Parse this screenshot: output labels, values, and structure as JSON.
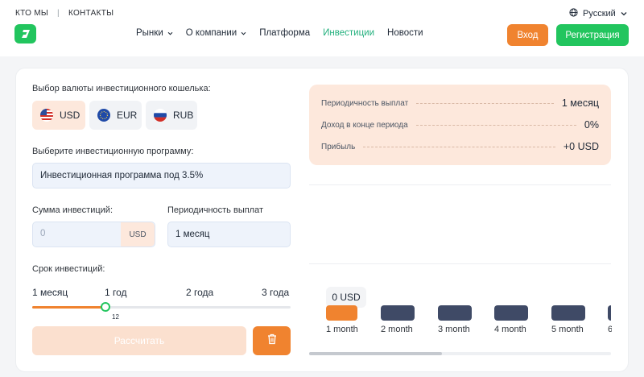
{
  "header": {
    "top_links": [
      "КТО МЫ",
      "КОНТАКТЫ"
    ],
    "language": "Русский",
    "nav": [
      {
        "label": "Рынки",
        "dropdown": true
      },
      {
        "label": "О компании",
        "dropdown": true
      },
      {
        "label": "Платформа",
        "dropdown": false
      },
      {
        "label": "Инвестиции",
        "dropdown": false,
        "active": true
      },
      {
        "label": "Новости",
        "dropdown": false
      }
    ],
    "login_label": "Вход",
    "register_label": "Регистрация"
  },
  "form": {
    "currency_label": "Выбор валюты инвестиционного кошелька:",
    "currencies": [
      {
        "code": "USD",
        "flag": "us-flag-icon",
        "selected": true
      },
      {
        "code": "EUR",
        "flag": "eu-flag-icon",
        "selected": false
      },
      {
        "code": "RUB",
        "flag": "ru-flag-icon",
        "selected": false
      }
    ],
    "program_label": "Выберите инвестиционную программу:",
    "program_value": "Инвестиционная программа под 3.5%",
    "amount_label": "Сумма инвестиций:",
    "amount_placeholder": "0",
    "amount_unit": "USD",
    "payout_label": "Периодичность выплат",
    "payout_value": "1 месяц",
    "term_label": "Срок инвестиций:",
    "term_ticks": [
      "1 месяц",
      "1 год",
      "2 года",
      "3 года"
    ],
    "term_value": "12",
    "term_min": 1,
    "term_max": 36,
    "calc_label": "Рассчитать"
  },
  "summary": {
    "rows": [
      {
        "label": "Периодичность выплат",
        "value": "1 месяц"
      },
      {
        "label": "Доход в конце периода",
        "value": "0%"
      },
      {
        "label": "Прибыль",
        "value": "+0 USD"
      }
    ]
  },
  "chart": {
    "tooltip": "0 USD",
    "labels": [
      "1 month",
      "2 month",
      "3 month",
      "4 month",
      "5 month",
      "6"
    ]
  },
  "colors": {
    "accent_orange": "#f0832f",
    "accent_green": "#22c55e",
    "bar_dark": "#3f4a66"
  }
}
